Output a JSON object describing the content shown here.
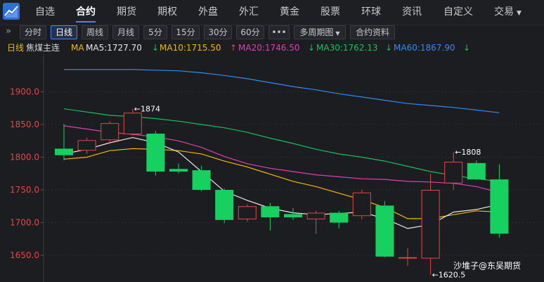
{
  "nav": {
    "items": [
      "自选",
      "合约",
      "期货",
      "期权",
      "外盘",
      "外汇",
      "黄金",
      "股票",
      "环球",
      "资讯",
      "自定义",
      "交易"
    ],
    "active": "合约"
  },
  "toolbar": {
    "collapse_icon": "double-chevron-right-icon",
    "buttons": [
      "分时",
      "日线",
      "周线",
      "月线",
      "5分",
      "15分",
      "30分",
      "60分",
      "•••",
      "多周期图",
      "合约资料"
    ],
    "active": "日线"
  },
  "indicator": {
    "period": "日线",
    "contract": "焦煤主连",
    "ma_label": "MA",
    "ma5": "MA5:1727.70",
    "ma10": "MA10:1715.50",
    "ma20": "MA20:1746.50",
    "ma30": "MA30:1762.13",
    "ma60": "MA60:1867.90",
    "arrow_down": "↓",
    "arrow_up": "↑"
  },
  "colors": {
    "up": "#e04848",
    "down": "#16d160",
    "ma5": "#e8e8e8",
    "ma10": "#f2b705",
    "ma20": "#e13fb5",
    "ma30": "#17c05e",
    "ma60": "#2f8cf0",
    "accent": "#3f86ff",
    "axis_label": "#e04848"
  },
  "chart_data": {
    "type": "candlestick",
    "ylim": [
      1620,
      1940
    ],
    "yticks": [
      "1900.0",
      "1850.0",
      "1800.0",
      "1750.0",
      "1700.0",
      "1650.0"
    ],
    "candles": [
      {
        "o": 1813,
        "c": 1803,
        "h": 1851,
        "l": 1795
      },
      {
        "o": 1810,
        "c": 1826,
        "h": 1830,
        "l": 1805
      },
      {
        "o": 1826,
        "c": 1852,
        "h": 1855,
        "l": 1820
      },
      {
        "o": 1835,
        "c": 1868,
        "h": 1874,
        "l": 1833
      },
      {
        "o": 1836,
        "c": 1778,
        "h": 1840,
        "l": 1772
      },
      {
        "o": 1782,
        "c": 1778,
        "h": 1790,
        "l": 1775
      },
      {
        "o": 1780,
        "c": 1750,
        "h": 1787,
        "l": 1748
      },
      {
        "o": 1750,
        "c": 1704,
        "h": 1752,
        "l": 1699
      },
      {
        "o": 1705,
        "c": 1725,
        "h": 1728,
        "l": 1701
      },
      {
        "o": 1725,
        "c": 1708,
        "h": 1730,
        "l": 1688
      },
      {
        "o": 1713,
        "c": 1708,
        "h": 1722,
        "l": 1704
      },
      {
        "o": 1705,
        "c": 1715,
        "h": 1718,
        "l": 1683
      },
      {
        "o": 1715,
        "c": 1700,
        "h": 1718,
        "l": 1691
      },
      {
        "o": 1710,
        "c": 1746,
        "h": 1750,
        "l": 1705
      },
      {
        "o": 1726,
        "c": 1648,
        "h": 1733,
        "l": 1647
      },
      {
        "o": 1645,
        "c": 1647,
        "h": 1661,
        "l": 1634
      },
      {
        "o": 1645,
        "c": 1750,
        "h": 1775,
        "l": 1620.5
      },
      {
        "o": 1760,
        "c": 1793,
        "h": 1808,
        "l": 1750
      },
      {
        "o": 1791,
        "c": 1766,
        "h": 1795,
        "l": 1765
      },
      {
        "o": 1766,
        "c": 1683,
        "h": 1789,
        "l": 1677
      }
    ],
    "ma": {
      "ma5": [
        1805,
        1812,
        1822,
        1830,
        1822,
        1808,
        1778,
        1748,
        1734,
        1722,
        1715,
        1712,
        1714,
        1716,
        1706,
        1691,
        1697,
        1716,
        1720,
        1728
      ],
      "ma10": [
        1797,
        1800,
        1810,
        1813,
        1812,
        1810,
        1805,
        1794,
        1785,
        1774,
        1763,
        1755,
        1745,
        1735,
        1723,
        1706,
        1706,
        1712,
        1718,
        1716
      ],
      "ma20": [
        1848,
        1843,
        1838,
        1835,
        1831,
        1825,
        1815,
        1801,
        1790,
        1783,
        1778,
        1773,
        1770,
        1767,
        1766,
        1763,
        1762,
        1760,
        1755,
        1746
      ],
      "ma30": [
        1874,
        1869,
        1864,
        1862,
        1859,
        1855,
        1850,
        1845,
        1838,
        1829,
        1821,
        1812,
        1805,
        1800,
        1794,
        1786,
        1778,
        1772,
        1767,
        1763
      ],
      "ma60": [
        1934,
        1934,
        1934,
        1934,
        1933,
        1932,
        1929,
        1925,
        1920,
        1914,
        1908,
        1903,
        1897,
        1892,
        1887,
        1882,
        1879,
        1876,
        1872,
        1868
      ]
    },
    "annotations": [
      {
        "text": "←1874",
        "candle": 3,
        "value": 1874
      },
      {
        "text": "←1808",
        "candle": 17,
        "value": 1808
      },
      {
        "text": "←1620.5",
        "candle": 16,
        "value": 1620.5
      }
    ]
  },
  "watermark": "沙堆子@东吴期货"
}
